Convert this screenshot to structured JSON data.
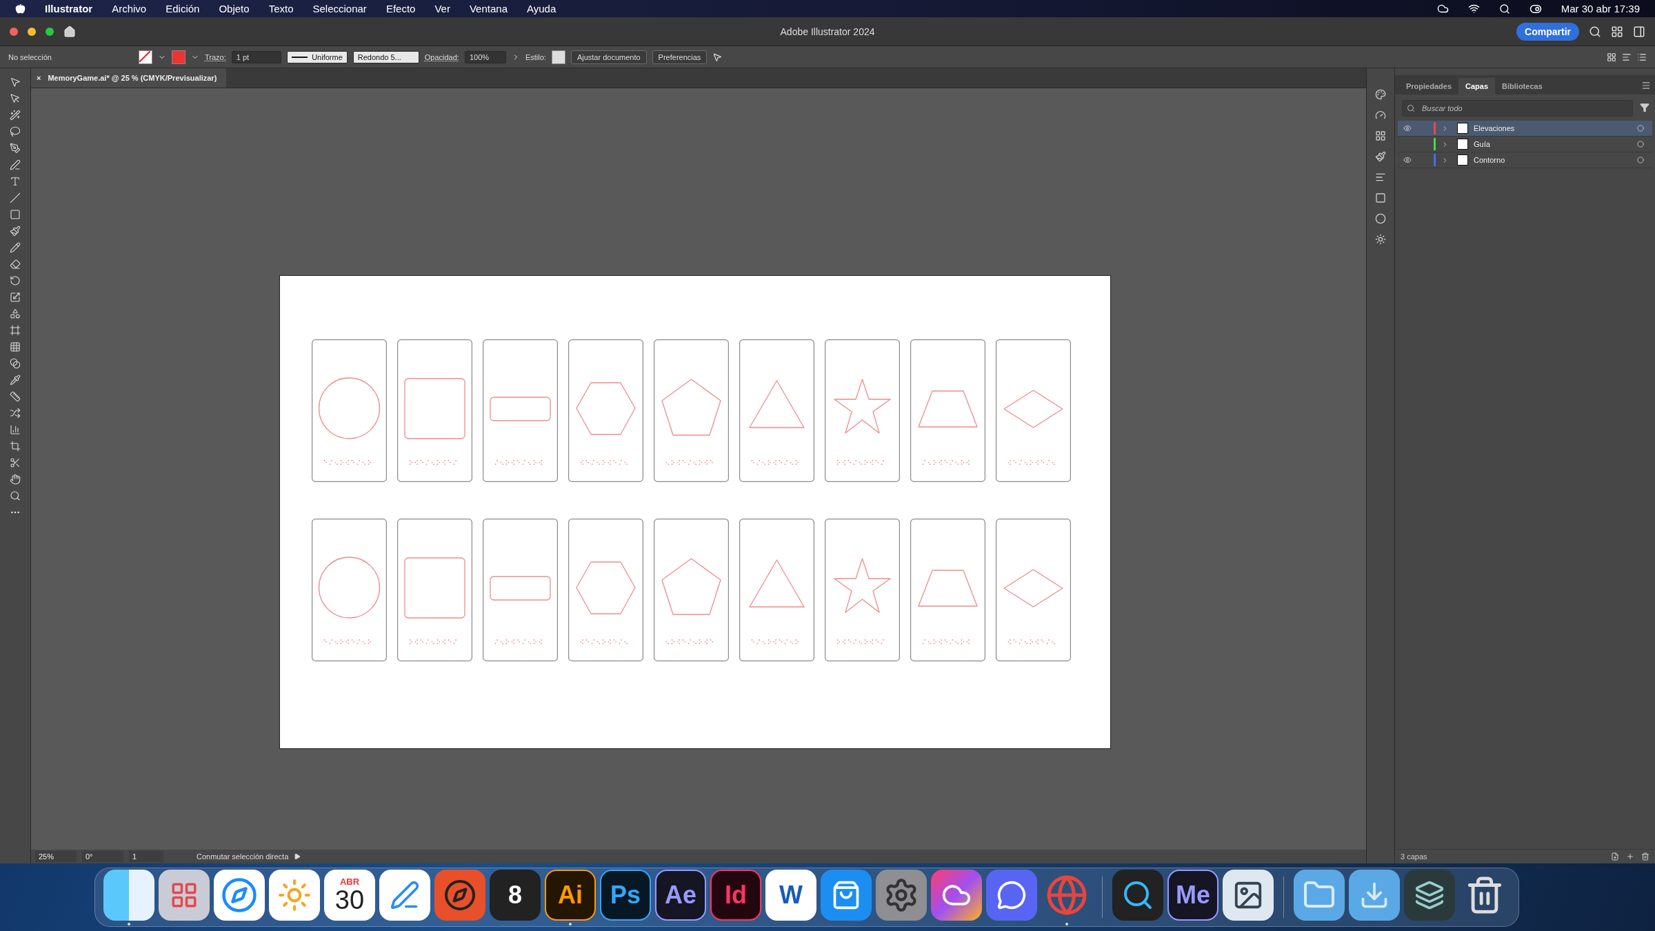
{
  "menu_bar": {
    "app": "Illustrator",
    "items": [
      "Archivo",
      "Edición",
      "Objeto",
      "Texto",
      "Seleccionar",
      "Efecto",
      "Ver",
      "Ventana",
      "Ayuda"
    ],
    "clock": "Mar 30 abr 17:39"
  },
  "title_bar": {
    "title": "Adobe Illustrator 2024",
    "share": "Compartir"
  },
  "control_bar": {
    "selection": "No selección",
    "stroke_label": "Trazo:",
    "stroke_weight": "1 pt",
    "profile": "Uniforme",
    "brush": "Redondo 5...",
    "opacity_label": "Opacidad:",
    "opacity": "100%",
    "style_label": "Estilo:",
    "buttons": [
      "Ajustar documento",
      "Preferencias"
    ]
  },
  "document_tab": {
    "title": "MemoryGame.ai* @ 25 % (CMYK/Previsualizar)",
    "close": "×"
  },
  "artboard": {
    "rows": [
      [
        {
          "kind": "circle"
        },
        {
          "kind": "square"
        },
        {
          "kind": "rectangle"
        },
        {
          "kind": "hexagon"
        },
        {
          "kind": "pentagon"
        },
        {
          "kind": "triangle"
        },
        {
          "kind": "star"
        },
        {
          "kind": "trapezoid"
        },
        {
          "kind": "diamond"
        }
      ],
      [
        {
          "kind": "circle"
        },
        {
          "kind": "square"
        },
        {
          "kind": "rectangle"
        },
        {
          "kind": "hexagon"
        },
        {
          "kind": "pentagon"
        },
        {
          "kind": "triangle"
        },
        {
          "kind": "star"
        },
        {
          "kind": "trapezoid"
        },
        {
          "kind": "diamond"
        }
      ]
    ]
  },
  "status_bar": {
    "zoom": "25%",
    "rotation": "0°",
    "artboard": "1",
    "info": "Conmutar selección directa"
  },
  "panel": {
    "tabs": [
      {
        "label": "Propiedades",
        "selected": false
      },
      {
        "label": "Capas",
        "selected": true
      },
      {
        "label": "Bibliotecas",
        "selected": false
      }
    ],
    "search": {
      "placeholder": "Buscar todo"
    },
    "layers": [
      {
        "name": "Elevaciones",
        "color": "#e84a4a",
        "visible": true,
        "selected": true
      },
      {
        "name": "Guía",
        "color": "#4cd64c",
        "visible": false,
        "selected": false
      },
      {
        "name": "Contorno",
        "color": "#4a6ee8",
        "visible": true,
        "selected": false
      }
    ],
    "footer": "3 capas"
  },
  "dock": {
    "items": [
      {
        "kind": "finder",
        "running": true
      },
      {
        "kind": "launchpad",
        "running": false
      },
      {
        "kind": "safari",
        "running": false
      },
      {
        "kind": "photos",
        "running": false
      },
      {
        "kind": "calendar",
        "month": "ABR",
        "day": "30",
        "running": false
      },
      {
        "kind": "freeform",
        "running": false
      },
      {
        "kind": "compass",
        "running": false
      },
      {
        "kind": "rhino",
        "text": "8",
        "running": false
      },
      {
        "kind": "letters",
        "text": "Ai",
        "color": "#ff9a00",
        "running": true
      },
      {
        "kind": "letters",
        "text": "Ps",
        "color": "#31a8ff",
        "running": false
      },
      {
        "kind": "letters",
        "text": "Ae",
        "color": "#9999ff",
        "running": false
      },
      {
        "kind": "letters",
        "text": "Id",
        "color": "#ff3366",
        "running": false
      },
      {
        "kind": "word",
        "text": "W",
        "running": false
      },
      {
        "kind": "appstore",
        "running": false
      },
      {
        "kind": "settings",
        "running": false
      },
      {
        "kind": "cloud",
        "running": false
      },
      {
        "kind": "discord",
        "running": false
      },
      {
        "kind": "chrome",
        "running": true
      },
      {
        "kind": "separator"
      },
      {
        "kind": "quicktime",
        "running": false
      },
      {
        "kind": "letters",
        "text": "Me",
        "color": "#9999ff",
        "running": false
      },
      {
        "kind": "preview",
        "running": false
      },
      {
        "kind": "separator"
      },
      {
        "kind": "folder",
        "running": false
      },
      {
        "kind": "downloads",
        "running": false
      },
      {
        "kind": "stack",
        "running": false
      },
      {
        "kind": "trash",
        "running": false
      }
    ]
  }
}
